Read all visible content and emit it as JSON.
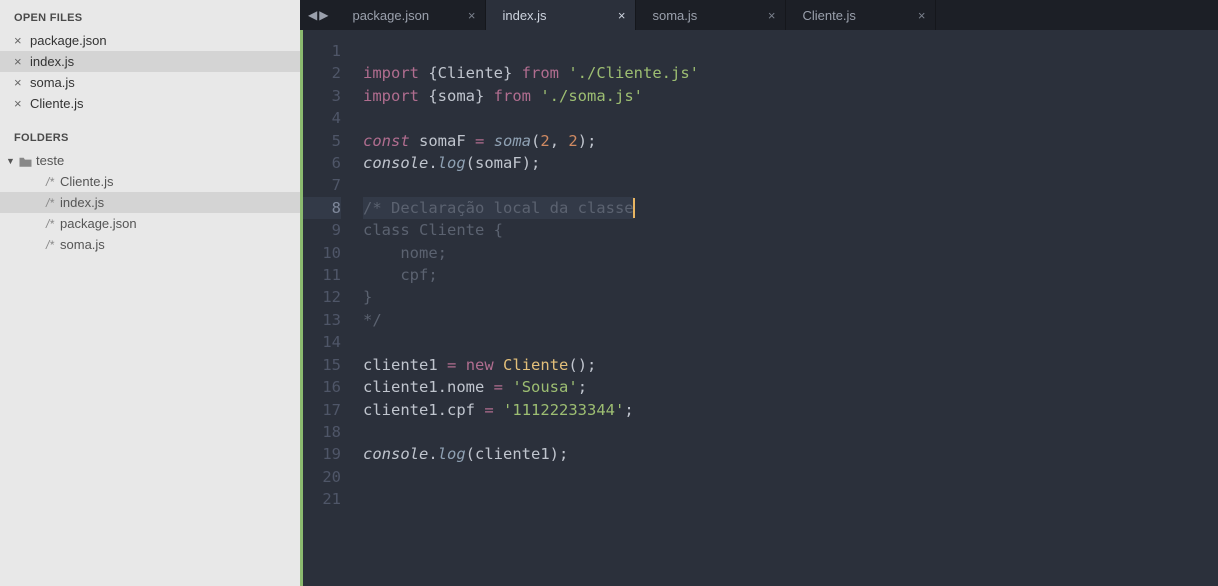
{
  "sidebar": {
    "sections": {
      "open_files_label": "OPEN FILES",
      "folders_label": "FOLDERS"
    },
    "open_files": [
      {
        "name": "package.json",
        "active": false
      },
      {
        "name": "index.js",
        "active": true
      },
      {
        "name": "soma.js",
        "active": false
      },
      {
        "name": "Cliente.js",
        "active": false
      }
    ],
    "folder_root": "teste",
    "tree_files": [
      {
        "name": "Cliente.js",
        "active": false
      },
      {
        "name": "index.js",
        "active": true
      },
      {
        "name": "package.json",
        "active": false
      },
      {
        "name": "soma.js",
        "active": false
      }
    ]
  },
  "tabs": [
    {
      "name": "package.json",
      "active": false
    },
    {
      "name": "index.js",
      "active": true
    },
    {
      "name": "soma.js",
      "active": false
    },
    {
      "name": "Cliente.js",
      "active": false
    }
  ],
  "editor": {
    "highlighted_line": 8,
    "lines": [
      {
        "n": 1,
        "t": []
      },
      {
        "n": 2,
        "t": [
          [
            "kw",
            "import"
          ],
          [
            "punc",
            " {"
          ],
          [
            "var",
            "Cliente"
          ],
          [
            "punc",
            "} "
          ],
          [
            "kw",
            "from"
          ],
          [
            "punc",
            " "
          ],
          [
            "str",
            "'./Cliente.js'"
          ]
        ]
      },
      {
        "n": 3,
        "t": [
          [
            "kw",
            "import"
          ],
          [
            "punc",
            " {"
          ],
          [
            "var",
            "soma"
          ],
          [
            "punc",
            "} "
          ],
          [
            "kw",
            "from"
          ],
          [
            "punc",
            " "
          ],
          [
            "str",
            "'./soma.js'"
          ]
        ]
      },
      {
        "n": 4,
        "t": []
      },
      {
        "n": 5,
        "t": [
          [
            "kw2",
            "const"
          ],
          [
            "punc",
            " "
          ],
          [
            "var",
            "somaF"
          ],
          [
            "punc",
            " "
          ],
          [
            "kw",
            "="
          ],
          [
            "punc",
            " "
          ],
          [
            "teal",
            "soma"
          ],
          [
            "punc",
            "("
          ],
          [
            "num",
            "2"
          ],
          [
            "punc",
            ", "
          ],
          [
            "num",
            "2"
          ],
          [
            "punc",
            ");"
          ]
        ]
      },
      {
        "n": 6,
        "t": [
          [
            "obj",
            "console"
          ],
          [
            "punc",
            "."
          ],
          [
            "teal",
            "log"
          ],
          [
            "punc",
            "("
          ],
          [
            "var",
            "somaF"
          ],
          [
            "punc",
            ");"
          ]
        ]
      },
      {
        "n": 7,
        "t": []
      },
      {
        "n": 8,
        "t": [
          [
            "com",
            "/* Declaração local da classe"
          ]
        ]
      },
      {
        "n": 9,
        "t": [
          [
            "com",
            "class Cliente {"
          ]
        ]
      },
      {
        "n": 10,
        "t": [
          [
            "com",
            "    nome;"
          ]
        ]
      },
      {
        "n": 11,
        "t": [
          [
            "com",
            "    cpf;"
          ]
        ]
      },
      {
        "n": 12,
        "t": [
          [
            "com",
            "}"
          ]
        ]
      },
      {
        "n": 13,
        "t": [
          [
            "com",
            "*/"
          ]
        ]
      },
      {
        "n": 14,
        "t": []
      },
      {
        "n": 15,
        "t": [
          [
            "var",
            "cliente1"
          ],
          [
            "punc",
            " "
          ],
          [
            "kw",
            "="
          ],
          [
            "punc",
            " "
          ],
          [
            "kw",
            "new"
          ],
          [
            "punc",
            " "
          ],
          [
            "cls",
            "Cliente"
          ],
          [
            "punc",
            "();"
          ]
        ]
      },
      {
        "n": 16,
        "t": [
          [
            "var",
            "cliente1"
          ],
          [
            "punc",
            "."
          ],
          [
            "var",
            "nome"
          ],
          [
            "punc",
            " "
          ],
          [
            "kw",
            "="
          ],
          [
            "punc",
            " "
          ],
          [
            "str",
            "'Sousa'"
          ],
          [
            "punc",
            ";"
          ]
        ]
      },
      {
        "n": 17,
        "t": [
          [
            "var",
            "cliente1"
          ],
          [
            "punc",
            "."
          ],
          [
            "var",
            "cpf"
          ],
          [
            "punc",
            " "
          ],
          [
            "kw",
            "="
          ],
          [
            "punc",
            " "
          ],
          [
            "str",
            "'11122233344'"
          ],
          [
            "punc",
            ";"
          ]
        ]
      },
      {
        "n": 18,
        "t": []
      },
      {
        "n": 19,
        "t": [
          [
            "obj",
            "console"
          ],
          [
            "punc",
            "."
          ],
          [
            "teal",
            "log"
          ],
          [
            "punc",
            "("
          ],
          [
            "var",
            "cliente1"
          ],
          [
            "punc",
            ");"
          ]
        ]
      },
      {
        "n": 20,
        "t": []
      },
      {
        "n": 21,
        "t": []
      }
    ]
  }
}
